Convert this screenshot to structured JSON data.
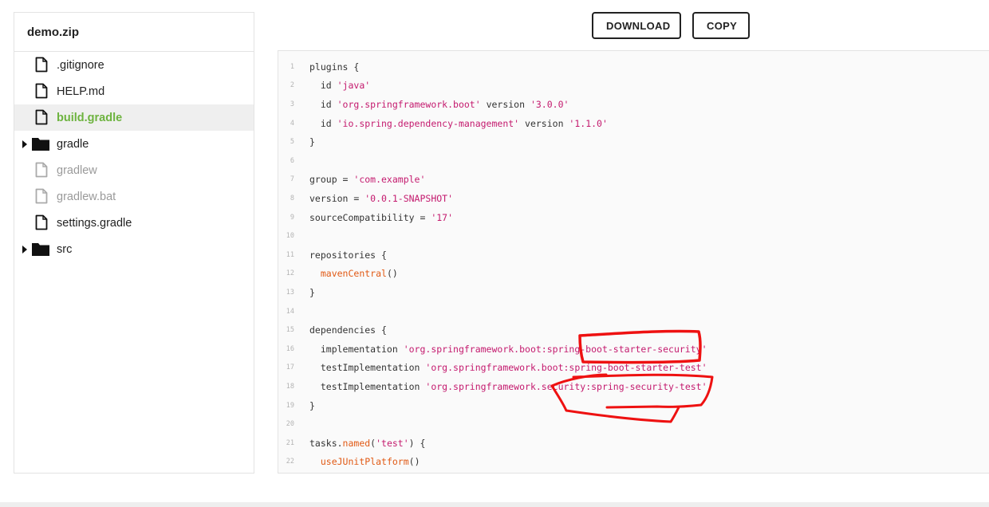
{
  "project": {
    "name": "demo.zip"
  },
  "files": [
    {
      "name": ".gitignore",
      "type": "file",
      "state": "normal"
    },
    {
      "name": "HELP.md",
      "type": "file",
      "state": "normal"
    },
    {
      "name": "build.gradle",
      "type": "file",
      "state": "selected"
    },
    {
      "name": "gradle",
      "type": "folder",
      "state": "collapsed"
    },
    {
      "name": "gradlew",
      "type": "file",
      "state": "muted"
    },
    {
      "name": "gradlew.bat",
      "type": "file",
      "state": "muted"
    },
    {
      "name": "settings.gradle",
      "type": "file",
      "state": "normal"
    },
    {
      "name": "src",
      "type": "folder",
      "state": "collapsed"
    }
  ],
  "toolbar": {
    "download_label": "DOWNLOAD",
    "copy_label": "COPY"
  },
  "code": {
    "filename": "build.gradle",
    "lines": [
      {
        "n": "1",
        "text": "plugins {"
      },
      {
        "n": "2",
        "text": "  id 'java'"
      },
      {
        "n": "3",
        "text": "  id 'org.springframework.boot' version '3.0.0'"
      },
      {
        "n": "4",
        "text": "  id 'io.spring.dependency-management' version '1.1.0'"
      },
      {
        "n": "5",
        "text": "}"
      },
      {
        "n": "6",
        "text": ""
      },
      {
        "n": "7",
        "text": "group = 'com.example'"
      },
      {
        "n": "8",
        "text": "version = '0.0.1-SNAPSHOT'"
      },
      {
        "n": "9",
        "text": "sourceCompatibility = '17'"
      },
      {
        "n": "10",
        "text": ""
      },
      {
        "n": "11",
        "text": "repositories {"
      },
      {
        "n": "12",
        "text": "  mavenCentral()"
      },
      {
        "n": "13",
        "text": "}"
      },
      {
        "n": "14",
        "text": ""
      },
      {
        "n": "15",
        "text": "dependencies {"
      },
      {
        "n": "16",
        "text": "  implementation 'org.springframework.boot:spring-boot-starter-security'"
      },
      {
        "n": "17",
        "text": "  testImplementation 'org.springframework.boot:spring-boot-starter-test'"
      },
      {
        "n": "18",
        "text": "  testImplementation 'org.springframework.security:spring-security-test'"
      },
      {
        "n": "19",
        "text": "}"
      },
      {
        "n": "20",
        "text": ""
      },
      {
        "n": "21",
        "text": "tasks.named('test') {"
      },
      {
        "n": "22",
        "text": "  useJUnitPlatform()"
      }
    ]
  },
  "colors": {
    "accent": "#6db33f",
    "string": "#c41a6e",
    "function": "#e15a15",
    "annotation": "#ee1111"
  },
  "icons": {
    "file": "file-icon",
    "folder": "folder-icon",
    "caret": "caret-right-icon"
  }
}
